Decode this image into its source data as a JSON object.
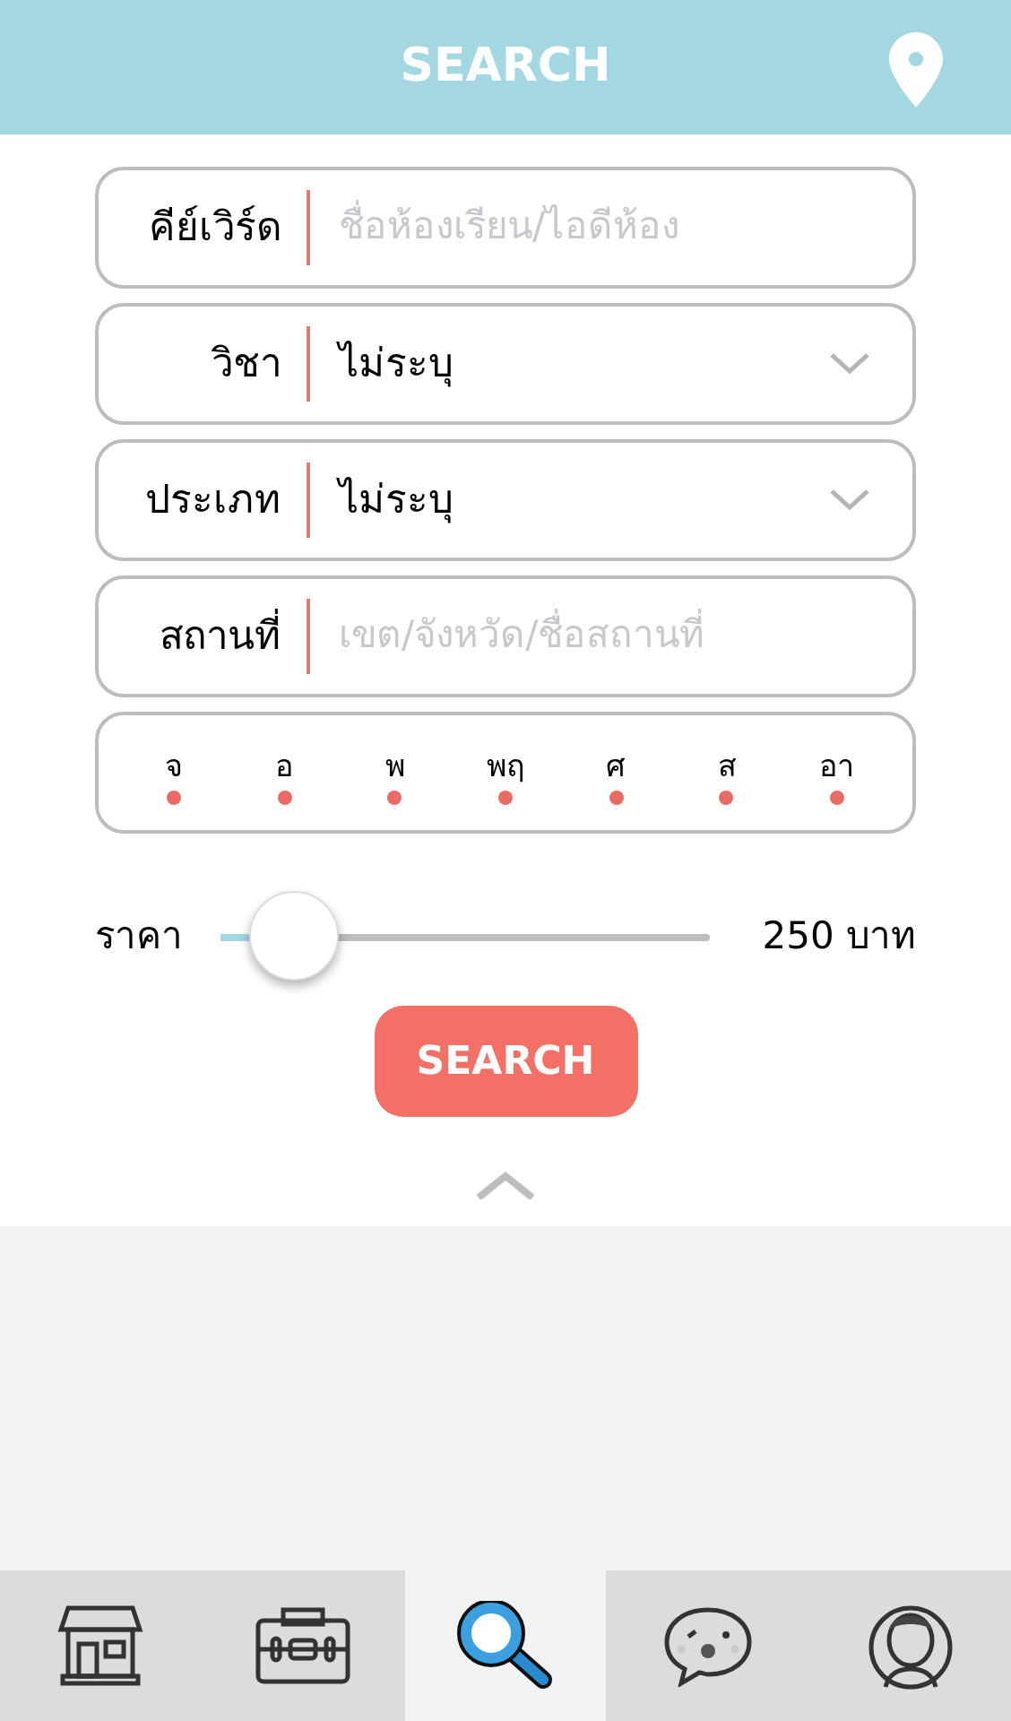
{
  "header": {
    "title": "SEARCH"
  },
  "fields": [
    {
      "kind": "text",
      "label": "คีย์เวิร์ด",
      "placeholder": "ชื่อห้องเรียน/ไอดีห้อง"
    },
    {
      "kind": "select",
      "label": "วิชา",
      "value": "ไม่ระบุ"
    },
    {
      "kind": "select",
      "label": "ประเภท",
      "value": "ไม่ระบุ"
    },
    {
      "kind": "text",
      "label": "สถานที่",
      "placeholder": "เขต/จังหวัด/ชื่อสถานที่"
    }
  ],
  "days": [
    "จ",
    "อ",
    "พ",
    "พฤ",
    "ศ",
    "ส",
    "อา"
  ],
  "price": {
    "label": "ราคา",
    "level": 0.15,
    "reading": "250 บาท"
  },
  "search_button": "SEARCH",
  "tabs": [
    {
      "kind": "shop",
      "selected": false
    },
    {
      "kind": "briefcase",
      "selected": false
    },
    {
      "kind": "search",
      "selected": true
    },
    {
      "kind": "chat",
      "selected": false
    },
    {
      "kind": "profile",
      "selected": false
    }
  ]
}
